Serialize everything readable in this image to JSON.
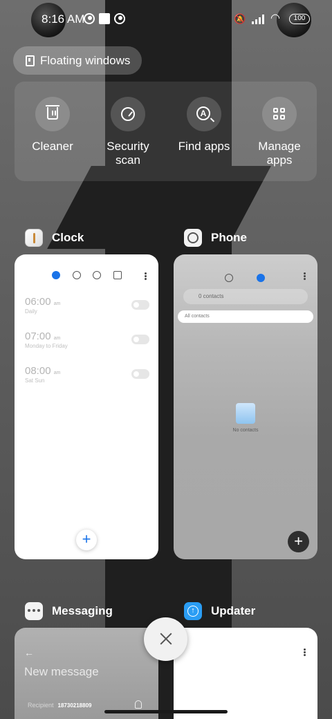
{
  "status_bar": {
    "time": "8:16 AM",
    "battery": "100"
  },
  "floating_windows": {
    "label": "Floating windows"
  },
  "tools": [
    {
      "label": "Cleaner",
      "icon": "trash-icon"
    },
    {
      "label": "Security\nscan",
      "icon": "gauge-icon"
    },
    {
      "label": "Find apps",
      "icon": "app-search-icon"
    },
    {
      "label": "Manage\napps",
      "icon": "grid-icon"
    }
  ],
  "apps": {
    "clock": {
      "name": "Clock",
      "alarms": [
        {
          "time": "06:00",
          "ampm": "am",
          "repeat": "Daily"
        },
        {
          "time": "07:00",
          "ampm": "am",
          "repeat": "Monday to Friday"
        },
        {
          "time": "08:00",
          "ampm": "am",
          "repeat": "Sat Sun"
        }
      ],
      "add": "+"
    },
    "phone": {
      "name": "Phone",
      "search_placeholder": "0 contacts",
      "filter": "All contacts",
      "empty": "No contacts",
      "add": "+"
    },
    "messaging": {
      "name": "Messaging",
      "back": "←",
      "title": "New message",
      "recipient_label": "Recipient",
      "recipient_value": "18730218809"
    },
    "updater": {
      "name": "Updater"
    }
  },
  "colors": {
    "accent_blue": "#1a73e8",
    "card_bg": "#ffffff",
    "dark_fab": "#2f2f2f"
  }
}
